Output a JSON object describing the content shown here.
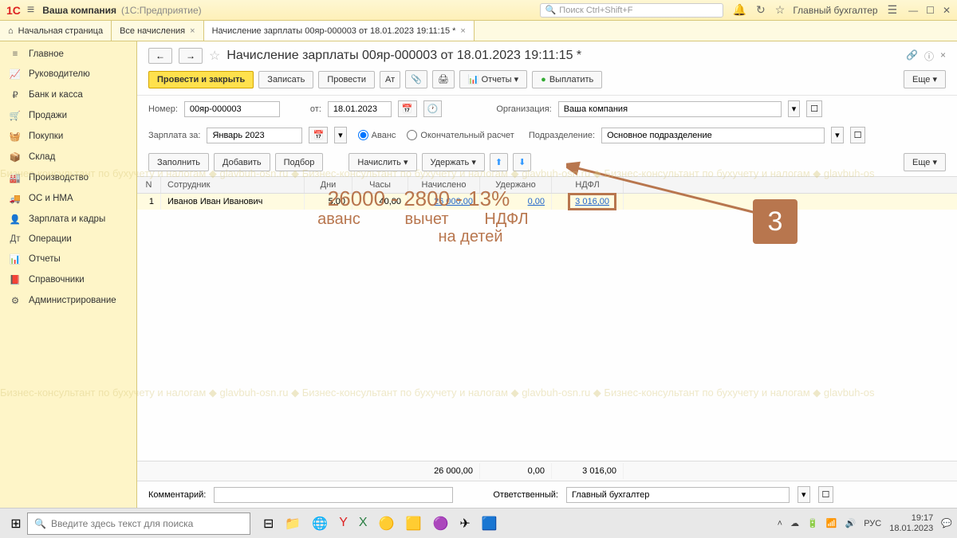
{
  "titlebar": {
    "logo": "1С",
    "company": "Ваша компания",
    "product": "(1С:Предприятие)",
    "search_placeholder": "Поиск Ctrl+Shift+F",
    "user": "Главный бухгалтер"
  },
  "tabs": {
    "home": "Начальная страница",
    "all_accruals": "Все начисления",
    "current": "Начисление зарплаты 00яр-000003 от 18.01.2023 19:11:15 *"
  },
  "sidebar": {
    "items": [
      {
        "icon": "≡",
        "label": "Главное"
      },
      {
        "icon": "📈",
        "label": "Руководителю"
      },
      {
        "icon": "₽",
        "label": "Банк и касса"
      },
      {
        "icon": "🛒",
        "label": "Продажи"
      },
      {
        "icon": "🧺",
        "label": "Покупки"
      },
      {
        "icon": "📦",
        "label": "Склад"
      },
      {
        "icon": "🏭",
        "label": "Производство"
      },
      {
        "icon": "🚚",
        "label": "ОС и НМА"
      },
      {
        "icon": "👤",
        "label": "Зарплата и кадры"
      },
      {
        "icon": "Дт",
        "label": "Операции"
      },
      {
        "icon": "📊",
        "label": "Отчеты"
      },
      {
        "icon": "📕",
        "label": "Справочники"
      },
      {
        "icon": "⚙",
        "label": "Администрирование"
      }
    ]
  },
  "doc": {
    "title": "Начисление зарплаты 00яр-000003 от 18.01.2023 19:11:15 *",
    "submit": "Провести и закрыть",
    "save": "Записать",
    "post": "Провести",
    "reports": "Отчеты",
    "pay": "Выплатить",
    "more": "Еще",
    "number_label": "Номер:",
    "number": "00яр-000003",
    "from_label": "от:",
    "date": "18.01.2023",
    "org_label": "Организация:",
    "org": "Ваша компания",
    "salary_for_label": "Зарплата за:",
    "salary_for": "Январь 2023",
    "advance": "Аванс",
    "final": "Окончательный расчет",
    "dept_label": "Подразделение:",
    "dept": "Основное подразделение",
    "fill": "Заполнить",
    "add": "Добавить",
    "select": "Подбор",
    "accrue": "Начислить",
    "deduct": "Удержать",
    "comment_label": "Комментарий:",
    "responsible_label": "Ответственный:",
    "responsible": "Главный бухгалтер"
  },
  "table": {
    "headers": {
      "n": "N",
      "employee": "Сотрудник",
      "days": "Дни",
      "hours": "Часы",
      "accrued": "Начислено",
      "deducted": "Удержано",
      "ndfl": "НДФЛ"
    },
    "rows": [
      {
        "n": "1",
        "employee": "Иванов Иван Иванович",
        "days": "5,00",
        "hours": "40,00",
        "accrued": "26 000,00",
        "deducted": "0,00",
        "ndfl": "3 016,00"
      }
    ],
    "totals": {
      "accrued": "26 000,00",
      "deducted": "0,00",
      "ndfl": "3 016,00"
    }
  },
  "annotation": {
    "formula": "26000 - 2800 - 13%",
    "sub1": "аванс",
    "sub2": "вычет",
    "sub3": "НДФЛ",
    "sub4": "на детей",
    "badge": "3"
  },
  "taskbar": {
    "search": "Введите здесь текст для поиска",
    "lang": "РУС",
    "time": "19:17",
    "date": "18.01.2023"
  },
  "watermark": "Бизнес-консультант по бухучету и налогам ◆ glavbuh-osn.ru ◆ Бизнес-консультант по бухучету и налогам ◆ glavbuh-osn.ru ◆ Бизнес-консультант по бухучету и налогам ◆ glavbuh-os"
}
